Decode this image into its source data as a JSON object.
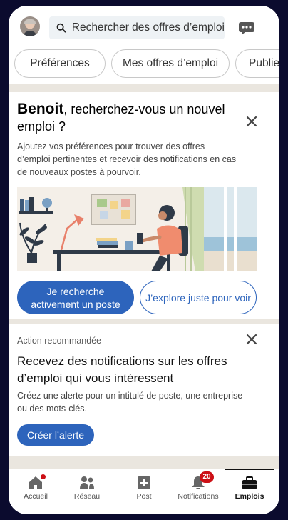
{
  "search": {
    "placeholder": "Rechercher des offres d’emploi"
  },
  "pills": [
    "Préférences",
    "Mes offres d’emploi",
    "Publier"
  ],
  "card1": {
    "name": "Benoit",
    "title_rest": ", recherchez-vous un nouvel emploi ?",
    "description": "Ajoutez vos préférences pour trouver des offres d’emploi pertinentes et recevoir des notifications en cas de nouveaux postes à pourvoir.",
    "primary_button": "Je recherche activement un poste",
    "secondary_button": "J’explore juste pour voir"
  },
  "card2": {
    "label": "Action recommandée",
    "title": "Recevez des notifications sur les offres d’emploi qui vous intéressent",
    "description": "Créez une alerte pour un intitulé de poste, une entreprise ou des mots-clés.",
    "button": "Créer l’alerte"
  },
  "nav": {
    "items": [
      {
        "label": "Accueil",
        "icon": "home-icon"
      },
      {
        "label": "Réseau",
        "icon": "network-icon"
      },
      {
        "label": "Post",
        "icon": "post-icon"
      },
      {
        "label": "Notifications",
        "icon": "bell-icon",
        "badge": "20"
      },
      {
        "label": "Emplois",
        "icon": "briefcase-icon",
        "active": true
      }
    ]
  },
  "colors": {
    "accent": "#2d64bc",
    "badge": "#cc1016",
    "feed_bg": "#eae6df"
  }
}
